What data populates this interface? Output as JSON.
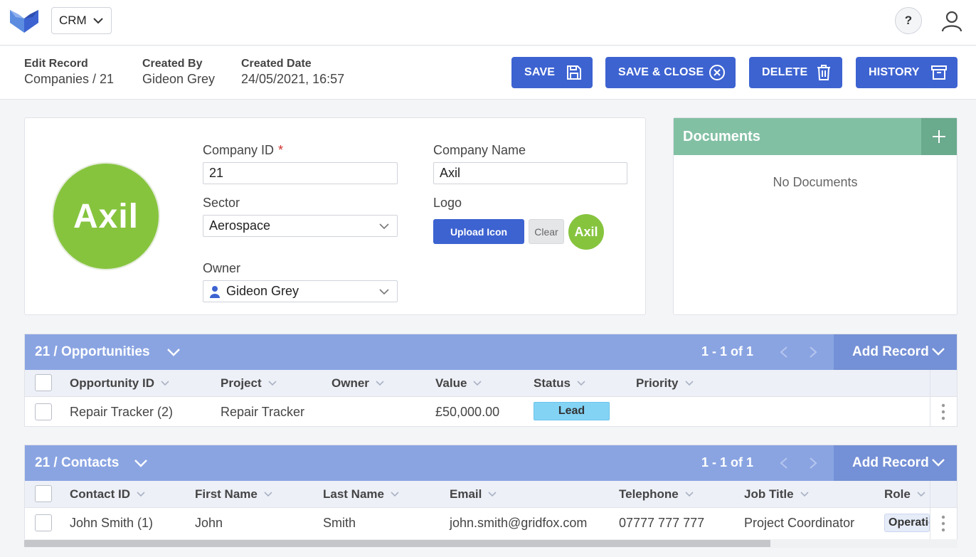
{
  "topbar": {
    "app_name": "CRM",
    "help_label": "?"
  },
  "record": {
    "edit_label": "Edit Record",
    "edit_value": "Companies / 21",
    "created_by_label": "Created By",
    "created_by_value": "Gideon Grey",
    "created_date_label": "Created Date",
    "created_date_value": "24/05/2021, 16:57",
    "buttons": {
      "save": "SAVE",
      "save_close": "SAVE & CLOSE",
      "delete": "DELETE",
      "history": "HISTORY"
    }
  },
  "form": {
    "avatar_text": "Axil",
    "company_id_label": "Company ID",
    "company_id_required": "*",
    "company_id_value": "21",
    "company_name_label": "Company Name",
    "company_name_value": "Axil",
    "sector_label": "Sector",
    "sector_value": "Aerospace",
    "logo_label": "Logo",
    "upload_label": "Upload Icon",
    "clear_label": "Clear",
    "logo_preview_text": "Axil",
    "owner_label": "Owner",
    "owner_value": "Gideon Grey"
  },
  "documents": {
    "title": "Documents",
    "empty_text": "No Documents"
  },
  "opportunities": {
    "title": "21 / Opportunities",
    "pager": "1 - 1 of 1",
    "add_record": "Add Record",
    "columns": [
      "Opportunity ID",
      "Project",
      "Owner",
      "Value",
      "Status",
      "Priority"
    ],
    "rows": [
      {
        "id": "Repair Tracker (2)",
        "project": "Repair Tracker",
        "owner": "",
        "value": "£50,000.00",
        "status": "Lead",
        "priority": ""
      }
    ]
  },
  "contacts": {
    "title": "21 / Contacts",
    "pager": "1 - 1 of 1",
    "add_record": "Add Record",
    "columns": [
      "Contact ID",
      "First Name",
      "Last Name",
      "Email",
      "Telephone",
      "Job Title",
      "Role"
    ],
    "rows": [
      {
        "id": "John Smith (1)",
        "first": "John",
        "last": "Smith",
        "email": "john.smith@gridfox.com",
        "telephone": "07777 777 777",
        "job_title": "Project Coordinator",
        "role": "Operations"
      }
    ]
  },
  "colors": {
    "primary": "#3d63d1",
    "grid_header": "#8aa4e2",
    "documents_header": "#82c0a4",
    "logo_green": "#86c43e",
    "status_lead": "#83d3f5"
  }
}
